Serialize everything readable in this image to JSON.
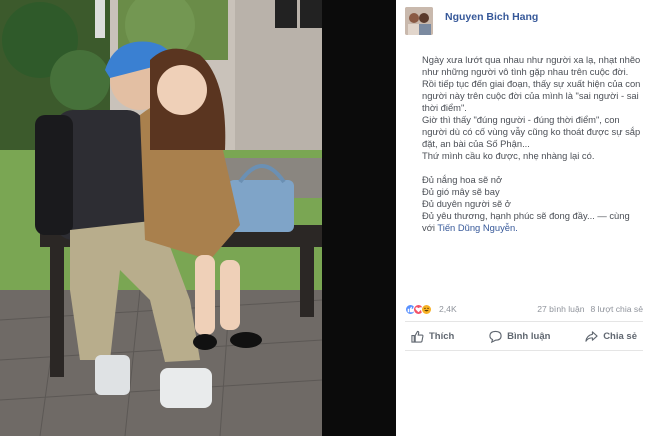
{
  "post": {
    "author": "Nguyen Bich Hang",
    "lines": [
      "Ngày xưa lướt qua nhau như người xa lạ, nhạt nhẽo",
      "như những người vô tình gặp nhau trên cuộc đời.",
      "Rồi tiếp tục đến giai đoạn, thấy sự xuất hiện của con",
      "người này trên cuộc đời của mình là \"sai người - sai",
      "thời điểm\".",
      "Giờ thì thấy \"đúng người - đúng thời điểm\", con",
      "người dù có cố vùng vẫy cũng ko thoát được sự sắp",
      "đặt, an bài của Số Phận...",
      "Thứ mình cầu ko được, nhẹ nhàng lại có."
    ],
    "lines2": [
      "Đủ nắng hoa sẽ nở",
      "Đủ gió mây sẽ bay",
      "Đủ duyên người sẽ ở",
      "Đủ yêu thương, hạnh phúc sẽ đong đầy... — cùng"
    ],
    "mention": "Tiến Dũng Nguyễn.",
    "mention_prefix": "với "
  },
  "reactions": {
    "icons": [
      "like-icon",
      "love-icon",
      "haha-icon"
    ],
    "colors": [
      "#5890ff",
      "#f25268",
      "#f7b125"
    ],
    "count": "2,4K",
    "comments": "27 bình luận",
    "shares": "8 lượt chia sẻ"
  },
  "actions": {
    "like": "Thích",
    "comment": "Bình luận",
    "share": "Chia sẻ"
  }
}
